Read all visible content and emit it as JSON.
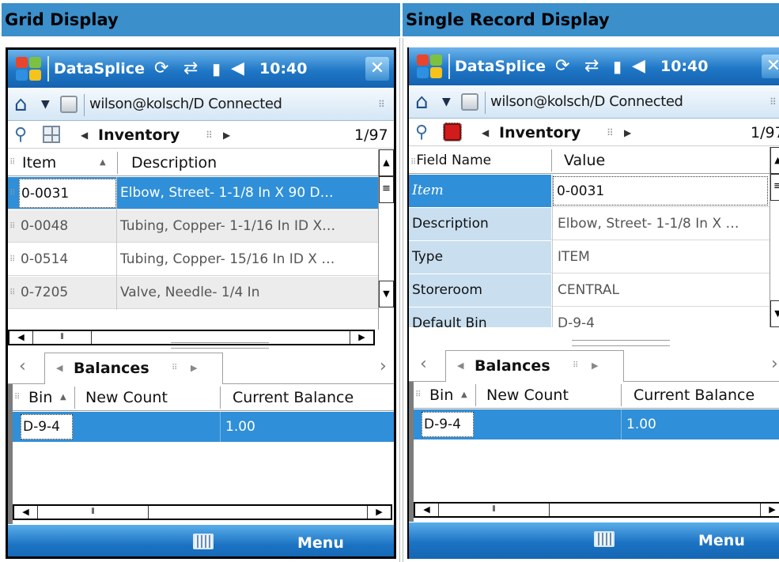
{
  "headers": {
    "left": "Grid Display",
    "right": "Single Record Display"
  },
  "device": {
    "app_title": "DataSplice",
    "time": "10:40",
    "close_label": "✕",
    "connection_text": "wilson@kolsch/D Connected",
    "view_title": "Inventory",
    "record_counter": "1/97"
  },
  "grid_view": {
    "columns": [
      "Item",
      "Description"
    ],
    "rows": [
      {
        "item": "0-0031",
        "description": "Elbow, Street- 1-1/8 In X 90 D…",
        "selected": true
      },
      {
        "item": "0-0048",
        "description": "Tubing, Copper- 1-1/16 In ID X…",
        "selected": false
      },
      {
        "item": "0-0514",
        "description": "Tubing, Copper- 15/16 In ID X …",
        "selected": false
      },
      {
        "item": "0-7205",
        "description": "Valve, Needle- 1/4 In",
        "selected": false
      }
    ]
  },
  "record_view": {
    "columns": [
      "Field Name",
      "Value"
    ],
    "fields": [
      {
        "name": "Item",
        "value": "0-0031",
        "selected": true
      },
      {
        "name": "Description",
        "value": "Elbow, Street- 1-1/8 In X …",
        "selected": false
      },
      {
        "name": "Type",
        "value": "ITEM",
        "selected": false
      },
      {
        "name": "Storeroom",
        "value": "CENTRAL",
        "selected": false
      },
      {
        "name": "Default Bin",
        "value": "D-9-4",
        "selected": false
      }
    ]
  },
  "balances": {
    "tab_label": "Balances",
    "columns": [
      "Bin",
      "New Count",
      "Current Balance"
    ],
    "row": {
      "bin": "D-9-4",
      "new_count": "",
      "current_balance": "1.00"
    }
  },
  "menubar": {
    "menu_label": "Menu"
  },
  "colors": {
    "header_bg": "#3b8fcb",
    "selection": "#2f8fd8",
    "titlebar": "#1f77c6"
  }
}
